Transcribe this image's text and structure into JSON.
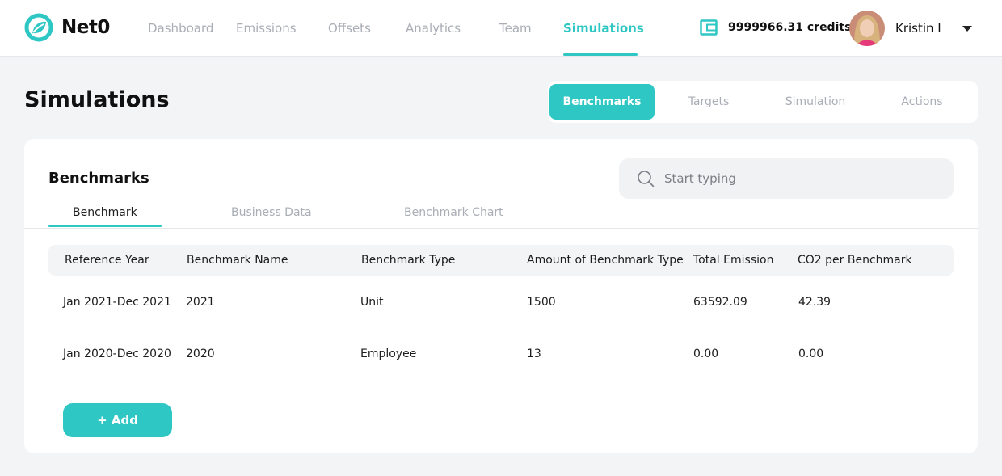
{
  "brand": {
    "name": "Net0",
    "accent": "#2ec7c4"
  },
  "nav": {
    "items": [
      {
        "label": "Dashboard"
      },
      {
        "label": "Emissions"
      },
      {
        "label": "Offsets"
      },
      {
        "label": "Analytics"
      },
      {
        "label": "Team"
      },
      {
        "label": "Simulations"
      }
    ],
    "active": "Simulations",
    "credits": "9999966.31 credits",
    "wallet_icon": "wallet-icon",
    "user": {
      "name": "Kristin I",
      "avatar": "user-avatar",
      "menu_icon": "caret-down-icon"
    }
  },
  "page": {
    "title": "Simulations",
    "section_tabs": [
      {
        "label": "Benchmarks"
      },
      {
        "label": "Targets"
      },
      {
        "label": "Simulation"
      },
      {
        "label": "Actions"
      }
    ],
    "active_section": "Benchmarks"
  },
  "card": {
    "title": "Benchmarks",
    "search": {
      "placeholder": "Start typing",
      "value": "",
      "icon": "search-icon"
    },
    "sub_tabs": [
      {
        "label": "Benchmark"
      },
      {
        "label": "Business Data"
      },
      {
        "label": "Benchmark Chart"
      }
    ],
    "active_sub_tab": "Benchmark",
    "table": {
      "columns": [
        "Reference Year",
        "Benchmark Name",
        "Benchmark Type",
        "Amount of Benchmark Type",
        "Total Emission",
        "CO2 per Benchmark"
      ],
      "rows": [
        [
          "Jan 2021-Dec 2021",
          "2021",
          "Unit",
          "1500",
          "63592.09",
          "42.39"
        ],
        [
          "Jan 2020-Dec 2020",
          "2020",
          "Employee",
          "13",
          "0.00",
          "0.00"
        ]
      ]
    },
    "add_button": "+ Add"
  }
}
